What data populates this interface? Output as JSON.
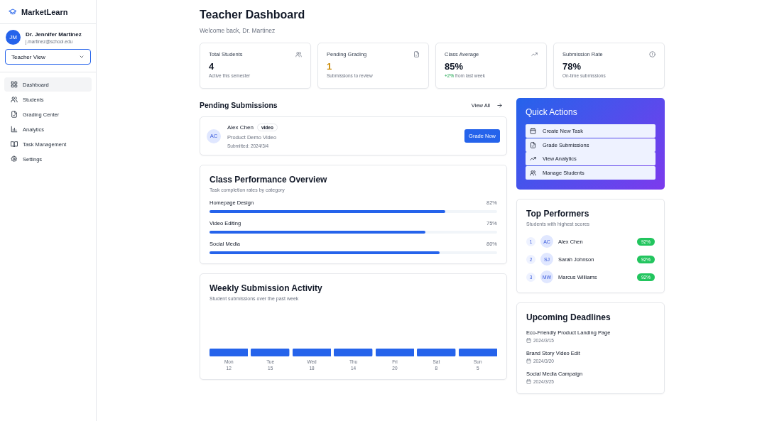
{
  "brand": "MarketLearn",
  "user": {
    "initials": "JM",
    "name": "Dr. Jennifer Martinez",
    "email": "j.martinez@school.edu"
  },
  "view_select": {
    "value": "Teacher View"
  },
  "nav": [
    {
      "label": "Dashboard",
      "selected": true
    },
    {
      "label": "Students",
      "selected": false
    },
    {
      "label": "Grading Center",
      "selected": false
    },
    {
      "label": "Analytics",
      "selected": false
    },
    {
      "label": "Task Management",
      "selected": false
    },
    {
      "label": "Settings",
      "selected": false
    }
  ],
  "header": {
    "title": "Teacher Dashboard",
    "subtitle": "Welcome back, Dr. Martinez"
  },
  "stats": [
    {
      "label": "Total Students",
      "value": "4",
      "color": "#111827",
      "note": "Active this semester"
    },
    {
      "label": "Pending Grading",
      "value": "1",
      "color": "#ca8a04",
      "note": "Submissions to review"
    },
    {
      "label": "Class Average",
      "value": "85%",
      "color": "#111827",
      "trend": "+2%",
      "note": "from last week"
    },
    {
      "label": "Submission Rate",
      "value": "78%",
      "color": "#111827",
      "note": "On-time submissions"
    }
  ],
  "pending": {
    "title": "Pending Submissions",
    "view_all": "View All",
    "items": [
      {
        "initials": "AC",
        "name": "Alex Chen",
        "tag": "video",
        "task": "Product Demo Video",
        "submitted": "Submitted: 2024/3/4",
        "action": "Grade Now"
      }
    ]
  },
  "performance": {
    "title": "Class Performance Overview",
    "subtitle": "Task completion rates by category",
    "rows": [
      {
        "name": "Homepage Design",
        "reading": "82%",
        "level": 0.82
      },
      {
        "name": "Video Editing",
        "reading": "75%",
        "level": 0.75
      },
      {
        "name": "Social Media",
        "reading": "80%",
        "level": 0.8
      }
    ]
  },
  "weekly": {
    "title": "Weekly Submission Activity",
    "subtitle": "Student submissions over the past week",
    "days": [
      {
        "day": "Mon",
        "count": "12"
      },
      {
        "day": "Tue",
        "count": "15"
      },
      {
        "day": "Wed",
        "count": "18"
      },
      {
        "day": "Thu",
        "count": "14"
      },
      {
        "day": "Fri",
        "count": "20"
      },
      {
        "day": "Sat",
        "count": "8"
      },
      {
        "day": "Sun",
        "count": "5"
      }
    ]
  },
  "quick_actions": {
    "title": "Quick Actions",
    "items": [
      "Create New Task",
      "Grade Submissions",
      "View Analytics",
      "Manage Students"
    ]
  },
  "top_performers": {
    "title": "Top Performers",
    "subtitle": "Students with highest scores",
    "rows": [
      {
        "rank": "1",
        "initials": "AC",
        "name": "Alex Chen",
        "score": "92%"
      },
      {
        "rank": "2",
        "initials": "SJ",
        "name": "Sarah Johnson",
        "score": "92%"
      },
      {
        "rank": "3",
        "initials": "MW",
        "name": "Marcus Williams",
        "score": "92%"
      }
    ]
  },
  "deadlines": {
    "title": "Upcoming Deadlines",
    "items": [
      {
        "title": "Eco-Friendly Product Landing Page",
        "date": "2024/3/15"
      },
      {
        "title": "Brand Story Video Edit",
        "date": "2024/3/20"
      },
      {
        "title": "Social Media Campaign",
        "date": "2024/3/25"
      }
    ]
  }
}
